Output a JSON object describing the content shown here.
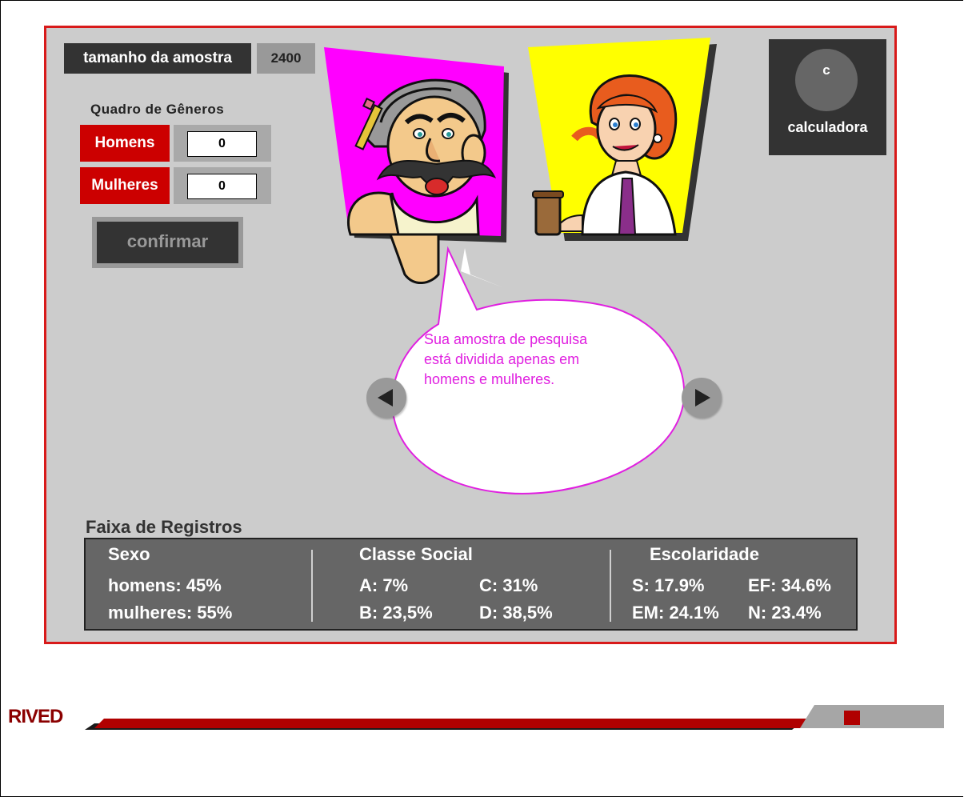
{
  "sample": {
    "label": "tamanho da amostra",
    "value": "2400"
  },
  "gender_board": {
    "title": "Quadro de  Gêneros",
    "men_label": "Homens",
    "men_value": "0",
    "women_label": "Mulheres",
    "women_value": "0",
    "confirm_label": "confirmar"
  },
  "calculator": {
    "key": "c",
    "label": "calculadora"
  },
  "speech_bubble": {
    "line1": "Sua amostra de pesquisa",
    "line2": "está dividida apenas em",
    "line3": "homens e mulheres."
  },
  "registry": {
    "title": "Faixa de Registros",
    "sex": {
      "header": "Sexo",
      "men": "homens: 45%",
      "women": "mulheres: 55%"
    },
    "social_class": {
      "header": "Classe Social",
      "a": "A: 7%",
      "b": "B: 23,5%",
      "c": "C: 31%",
      "d": "D: 38,5%"
    },
    "education": {
      "header": "Escolaridade",
      "s": "S: 17.9%",
      "ef": "EF: 34.6%",
      "em": "EM: 24.1%",
      "n": "N: 23.4%"
    }
  },
  "footer": {
    "logo": "RIVED"
  },
  "colors": {
    "stage_bg": "#cccccc",
    "stage_border": "#d81a1a",
    "gender_red": "#cc0000",
    "bubble_text": "#e020e0",
    "panel_bg": "#666666",
    "footer_red": "#8b0000"
  }
}
